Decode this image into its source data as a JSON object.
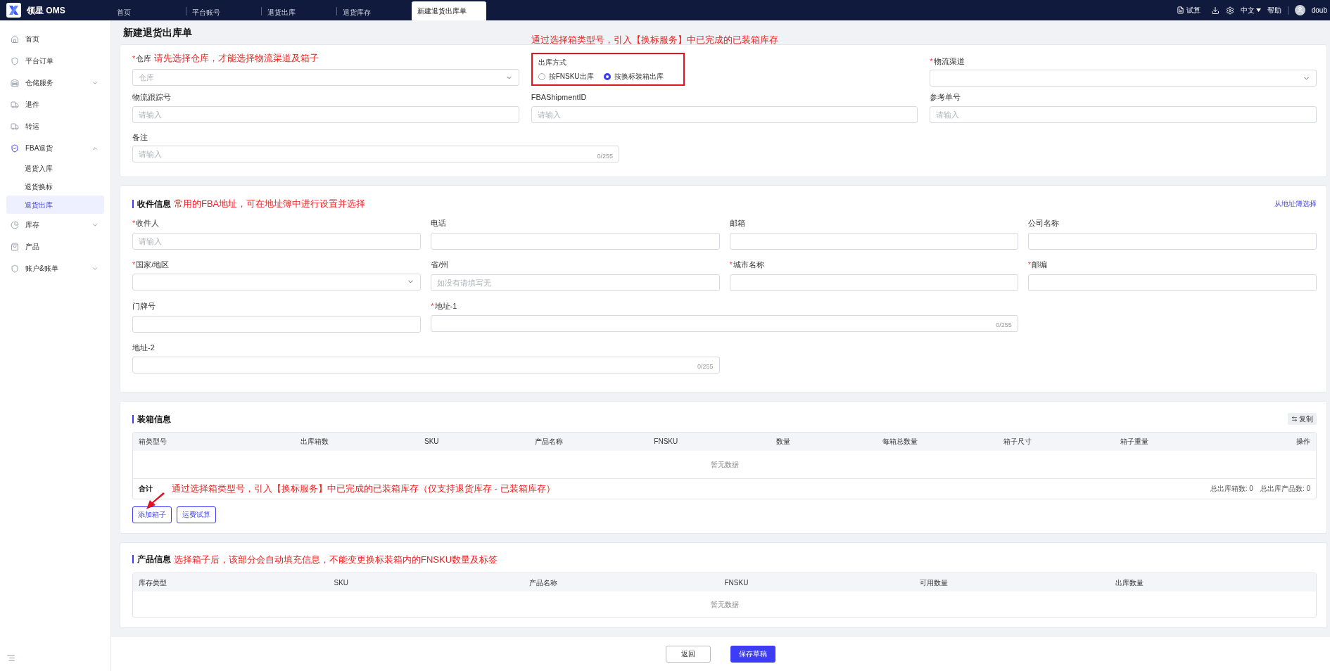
{
  "app": {
    "name": "领星 OMS"
  },
  "required_mark": "*",
  "tabs": [
    {
      "label": "首页",
      "selected": false
    },
    {
      "label": "平台账号",
      "selected": false
    },
    {
      "label": "退货出库",
      "selected": false
    },
    {
      "label": "退货库存",
      "selected": false
    },
    {
      "label": "新建退货出库单",
      "selected": true
    }
  ],
  "header_actions": {
    "calc": "试算",
    "language": "中文",
    "help": "帮助",
    "user": "doub"
  },
  "sidebar": {
    "items": [
      {
        "label": "首页",
        "kind": "link",
        "selected": false
      },
      {
        "label": "平台订单",
        "kind": "link",
        "selected": false
      },
      {
        "label": "仓储服务",
        "kind": "group",
        "expanded": false,
        "selected": false
      },
      {
        "label": "退件",
        "kind": "link",
        "selected": false
      },
      {
        "label": "转运",
        "kind": "link",
        "selected": false
      },
      {
        "label": "FBA退货",
        "kind": "group",
        "expanded": true,
        "selected": false,
        "children": [
          {
            "label": "退货入库",
            "selected": false
          },
          {
            "label": "退货换标",
            "selected": false
          },
          {
            "label": "退货出库",
            "selected": true
          }
        ]
      },
      {
        "label": "库存",
        "kind": "group",
        "expanded": false,
        "selected": false
      },
      {
        "label": "产品",
        "kind": "link",
        "selected": false
      },
      {
        "label": "账户&账单",
        "kind": "group",
        "expanded": false,
        "selected": false
      }
    ]
  },
  "page_title": "新建退货出库单",
  "basic": {
    "warehouse": {
      "label": "仓库",
      "required": true,
      "placeholder": "仓库",
      "annotation": "请先选择仓库，才能选择物流渠道及箱子"
    },
    "method": {
      "label": "出库方式",
      "annotation": "通过选择箱类型号，引入【换标服务】中已完成的已装箱库存",
      "highlighted": true,
      "options": [
        {
          "label": "按FNSKU出库",
          "selected": false
        },
        {
          "label": "按换标装箱出库",
          "selected": true
        }
      ]
    },
    "channel": {
      "label": "物流渠道",
      "required": true
    },
    "fields": [
      {
        "label": "物流跟踪号",
        "placeholder": "请输入"
      },
      {
        "label": "FBAShipmentID",
        "placeholder": "请输入"
      },
      {
        "label": "参考单号",
        "placeholder": "请输入"
      }
    ],
    "remark": {
      "label": "备注",
      "placeholder": "请输入",
      "counter": "0/255"
    }
  },
  "recipient": {
    "title": "收件信息",
    "annotation": "常用的FBA地址，可在地址簿中进行设置并选择",
    "link": "从地址簿选择",
    "fields": [
      {
        "label": "收件人",
        "required": true,
        "kind": "input",
        "placeholder": "请输入"
      },
      {
        "label": "电话",
        "required": false,
        "kind": "input"
      },
      {
        "label": "邮箱",
        "required": false,
        "kind": "input"
      },
      {
        "label": "公司名称",
        "required": false,
        "kind": "input"
      },
      {
        "label": "国家/地区",
        "required": true,
        "kind": "select"
      },
      {
        "label": "省/州",
        "required": false,
        "kind": "input",
        "placeholder": "如没有请填写无"
      },
      {
        "label": "城市名称",
        "required": true,
        "kind": "input"
      },
      {
        "label": "邮编",
        "required": true,
        "kind": "input"
      },
      {
        "label": "门牌号",
        "required": false,
        "kind": "input"
      },
      {
        "label": "地址-1",
        "required": true,
        "kind": "textarea",
        "counter": "0/255"
      },
      {
        "label": "地址-2",
        "required": false,
        "kind": "textarea",
        "counter": "0/255"
      }
    ]
  },
  "packing": {
    "title": "装箱信息",
    "copy_button": "复制",
    "columns": [
      "箱类型号",
      "出库箱数",
      "SKU",
      "产品名称",
      "FNSKU",
      "数量",
      "每箱总数量",
      "箱子尺寸",
      "箱子重量",
      "操作"
    ],
    "empty": "暂无数据",
    "total_label": "合计",
    "annotation": "通过选择箱类型号，引入【换标服务】中已完成的已装箱库存（仅支持退货库存 - 已装箱库存）",
    "totals": [
      "总出库箱数: 0",
      "总出库产品数: 0"
    ],
    "buttons": [
      "添加箱子",
      "运费试算"
    ]
  },
  "products": {
    "title": "产品信息",
    "annotation": "选择箱子后，该部分会自动填充信息，不能变更换标装箱内的FNSKU数量及标签",
    "columns": [
      "库存类型",
      "SKU",
      "产品名称",
      "FNSKU",
      "可用数量",
      "出库数量"
    ],
    "empty": "暂无数据"
  },
  "footer": {
    "back": "返回",
    "save": "保存草稿"
  }
}
